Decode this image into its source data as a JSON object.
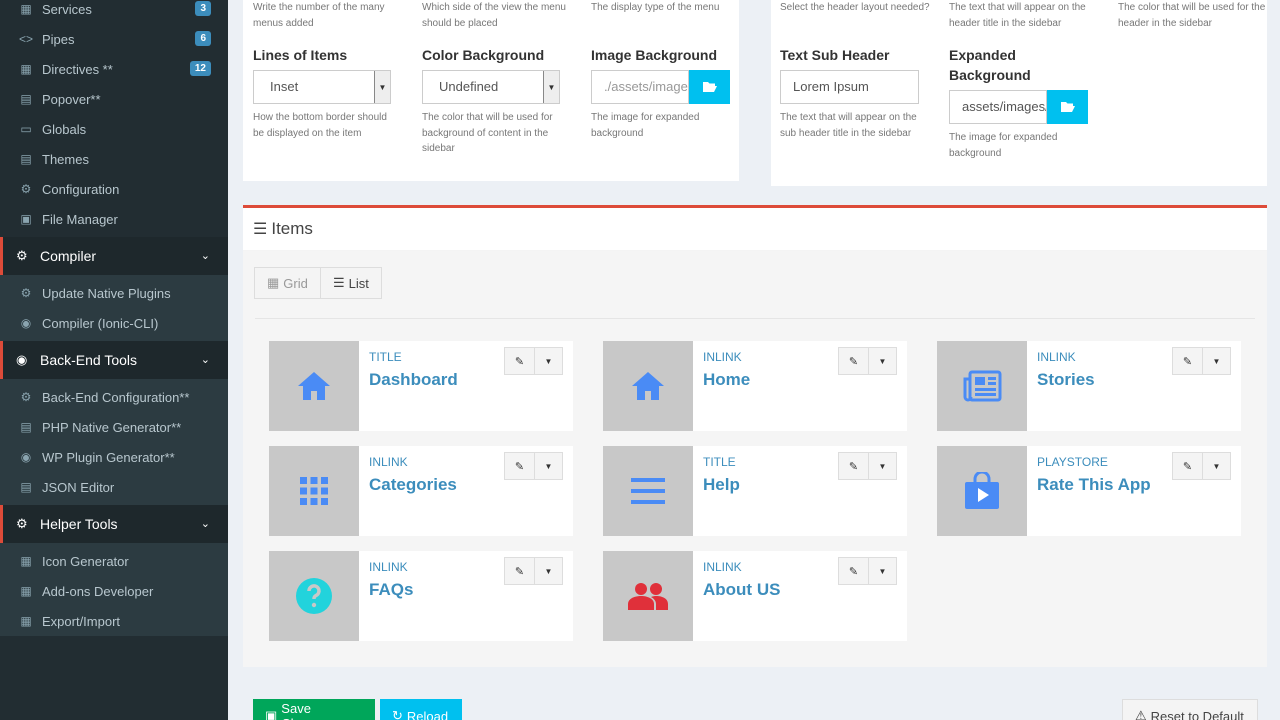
{
  "sidebar": {
    "items_top": [
      {
        "label": "Services",
        "badge": "3",
        "icon": "cubes-icon"
      },
      {
        "label": "Pipes",
        "badge": "6",
        "icon": "code-icon"
      },
      {
        "label": "Directives **",
        "badge": "12",
        "icon": "puzzle-icon"
      },
      {
        "label": "Popover**",
        "badge": "",
        "icon": "comment-icon"
      },
      {
        "label": "Globals",
        "badge": "",
        "icon": "globe-icon"
      },
      {
        "label": "Themes",
        "badge": "",
        "icon": "file-icon"
      },
      {
        "label": "Configuration",
        "badge": "",
        "icon": "gear-icon"
      },
      {
        "label": "File Manager",
        "badge": "",
        "icon": "image-icon"
      }
    ],
    "sections": [
      {
        "label": "Compiler",
        "items": [
          "Update Native Plugins",
          "Compiler (Ionic-CLI)"
        ]
      },
      {
        "label": "Back-End Tools",
        "items": [
          "Back-End Configuration**",
          "PHP Native Generator**",
          "WP Plugin Generator**",
          "JSON Editor"
        ]
      },
      {
        "label": "Helper Tools",
        "items": [
          "Icon Generator",
          "Add-ons Developer",
          "Export/Import"
        ]
      }
    ]
  },
  "form_left": {
    "help_top": [
      "Write the number of the many menus added",
      "Which side of the view the menu should be placed",
      "The display type of the menu"
    ],
    "lines_label": "Lines of Items",
    "lines_value": "Inset",
    "lines_help": "How the bottom border should be displayed on the item",
    "color_label": "Color Background",
    "color_value": "Undefined",
    "color_help": "The color that will be used for background of content in the sidebar",
    "image_label": "Image Background",
    "image_value": "./assets/images/",
    "image_help": "The image for expanded background"
  },
  "form_right": {
    "help_top": [
      "Select the header layout needed?",
      "The text that will appear on the header title in the sidebar",
      "The color that will be used for the header in the sidebar"
    ],
    "subheader_label": "Text Sub Header",
    "subheader_value": "Lorem Ipsum",
    "subheader_help": "The text that will appear on the sub header title in the sidebar",
    "expanded_label": "Expanded Background",
    "expanded_value": "assets/images/",
    "expanded_help": "The image for expanded background"
  },
  "items_panel": {
    "title": "Items",
    "grid_label": "Grid",
    "list_label": "List",
    "cards": [
      {
        "type": "TITLE",
        "title": "Dashboard",
        "icon": "home-icon",
        "color": "#4a8bf5"
      },
      {
        "type": "INLINK",
        "title": "Home",
        "icon": "home-icon",
        "color": "#4a8bf5"
      },
      {
        "type": "INLINK",
        "title": "Stories",
        "icon": "newspaper-icon",
        "color": "#4a8bf5"
      },
      {
        "type": "INLINK",
        "title": "Categories",
        "icon": "apps-grid-icon",
        "color": "#4a8bf5"
      },
      {
        "type": "TITLE",
        "title": "Help",
        "icon": "menu-lines-icon",
        "color": "#4a8bf5"
      },
      {
        "type": "PLAYSTORE",
        "title": "Rate This App",
        "icon": "shopping-bag-icon",
        "color": "#4a8bf5"
      },
      {
        "type": "INLINK",
        "title": "FAQs",
        "icon": "question-circle-icon",
        "color": "#22d3dc"
      },
      {
        "type": "INLINK",
        "title": "About US",
        "icon": "people-icon",
        "color": "#e0303a"
      }
    ]
  },
  "footer": {
    "save_label": "Save Changes",
    "reload_label": "Reload",
    "reset_label": "Reset to Default"
  }
}
